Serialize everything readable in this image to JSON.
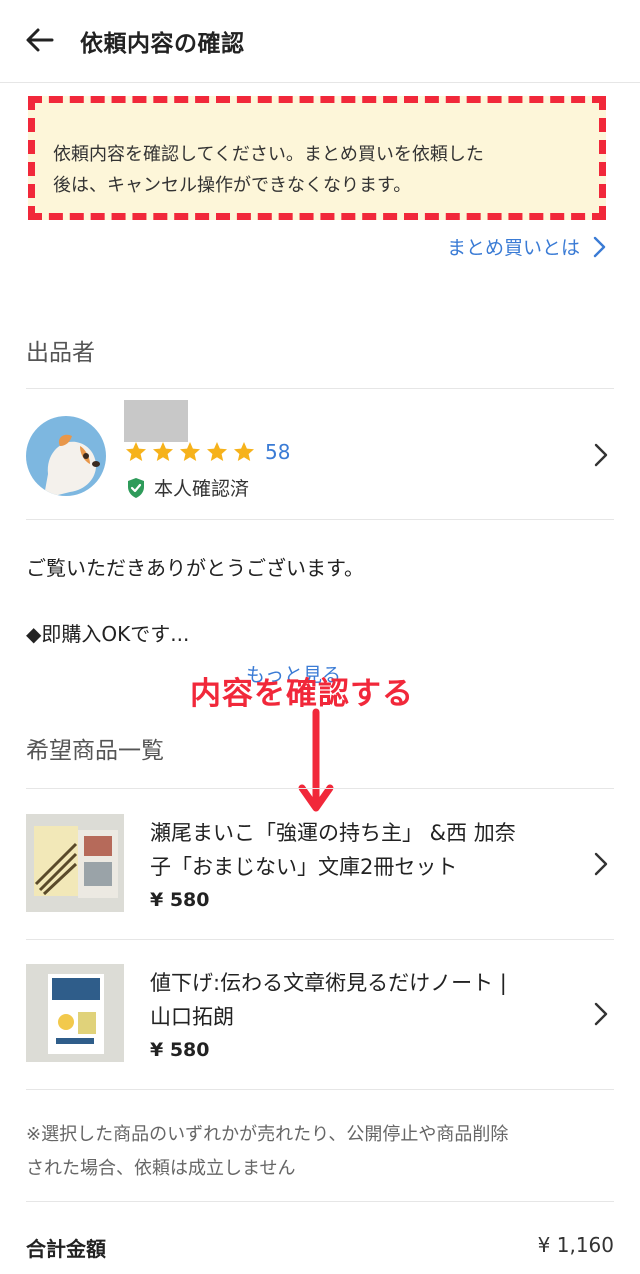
{
  "header": {
    "title": "依頼内容の確認",
    "back_icon": "arrow-left-icon"
  },
  "notice": {
    "line1": "依頼内容を確認してください。まとめ買いを依頼した",
    "line2": "後は、キャンセル操作ができなくなります。",
    "background": "#fdf6d9",
    "border_color": "#f1283a"
  },
  "help_link": {
    "label": "まとめ買いとは"
  },
  "seller": {
    "section_title": "出品者",
    "rating_count": "58",
    "star_count": 5,
    "verified_label": "本人確認済",
    "intro_line1": "ご覧いただきありがとうございます。",
    "intro_line2": "◆即購入OKです...",
    "more_label": "もっと見る"
  },
  "annotation": {
    "text": "内容を確認する",
    "color": "#f1283a"
  },
  "items_section": {
    "title": "希望商品一覧"
  },
  "items": [
    {
      "title_line1": "瀬尾まいこ「強運の持ち主」 &西 加奈",
      "title_line2": "子「おまじない」文庫2冊セット",
      "price": "¥ 580"
    },
    {
      "title_line1": "値下げ:伝わる文章術見るだけノート |",
      "title_line2": "山口拓朗",
      "price": "¥ 580"
    }
  ],
  "note": {
    "line1": "※選択した商品のいずれかが売れたり、公開停止や商品削除",
    "line2": "された場合、依頼は成立しません"
  },
  "total": {
    "label": "合計金額",
    "value": "¥ 1,160"
  },
  "colors": {
    "accent_blue": "#3a7bd5",
    "star_yellow": "#f6b21b",
    "verified_green": "#2e9b5a"
  }
}
